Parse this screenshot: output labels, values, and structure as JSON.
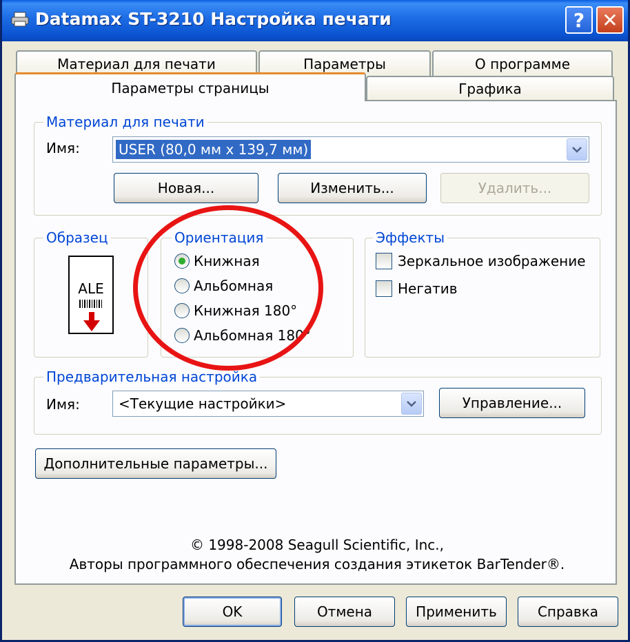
{
  "window": {
    "title": "Datamax ST-3210 Настройка печати",
    "help_label": "?",
    "close_label": "✕"
  },
  "tabs": [
    {
      "label": "Материал для печати",
      "active": false
    },
    {
      "label": "Параметры",
      "active": false
    },
    {
      "label": "О программе",
      "active": false
    },
    {
      "label": "Параметры страницы",
      "active": true
    },
    {
      "label": "Графика",
      "active": false
    }
  ],
  "stock": {
    "group_title": "Материал для печати",
    "name_label": "Имя:",
    "name_value": "USER (80,0 мм x 139,7 мм)",
    "new_button": "Новая...",
    "edit_button": "Изменить...",
    "delete_button": "Удалить..."
  },
  "sample": {
    "group_title": "Образец",
    "preview_text": "ALE"
  },
  "orientation": {
    "group_title": "Ориентация",
    "options": [
      {
        "label": "Книжная",
        "checked": true
      },
      {
        "label": "Альбомная",
        "checked": false
      },
      {
        "label": "Книжная 180°",
        "checked": false
      },
      {
        "label": "Альбомная 180°",
        "checked": false
      }
    ]
  },
  "effects": {
    "group_title": "Эффекты",
    "options": [
      {
        "label": "Зеркальное изображение",
        "checked": false
      },
      {
        "label": "Негатив",
        "checked": false
      }
    ]
  },
  "preset": {
    "group_title": "Предварительная настройка",
    "name_label": "Имя:",
    "name_value": "<Текущие настройки>",
    "manage_button": "Управление..."
  },
  "advanced_button": "Дополнительные параметры...",
  "copyright": {
    "line1": "© 1998-2008 Seagull Scientific, Inc.,",
    "line2": "Авторы программного обеспечения создания этикеток BarTender®."
  },
  "footer": {
    "ok": "OK",
    "cancel": "Отмена",
    "apply": "Применить",
    "help": "Справка"
  },
  "colors": {
    "annotation_circle": "#e81414",
    "group_title": "#0046d5",
    "selection": "#316ac5"
  }
}
